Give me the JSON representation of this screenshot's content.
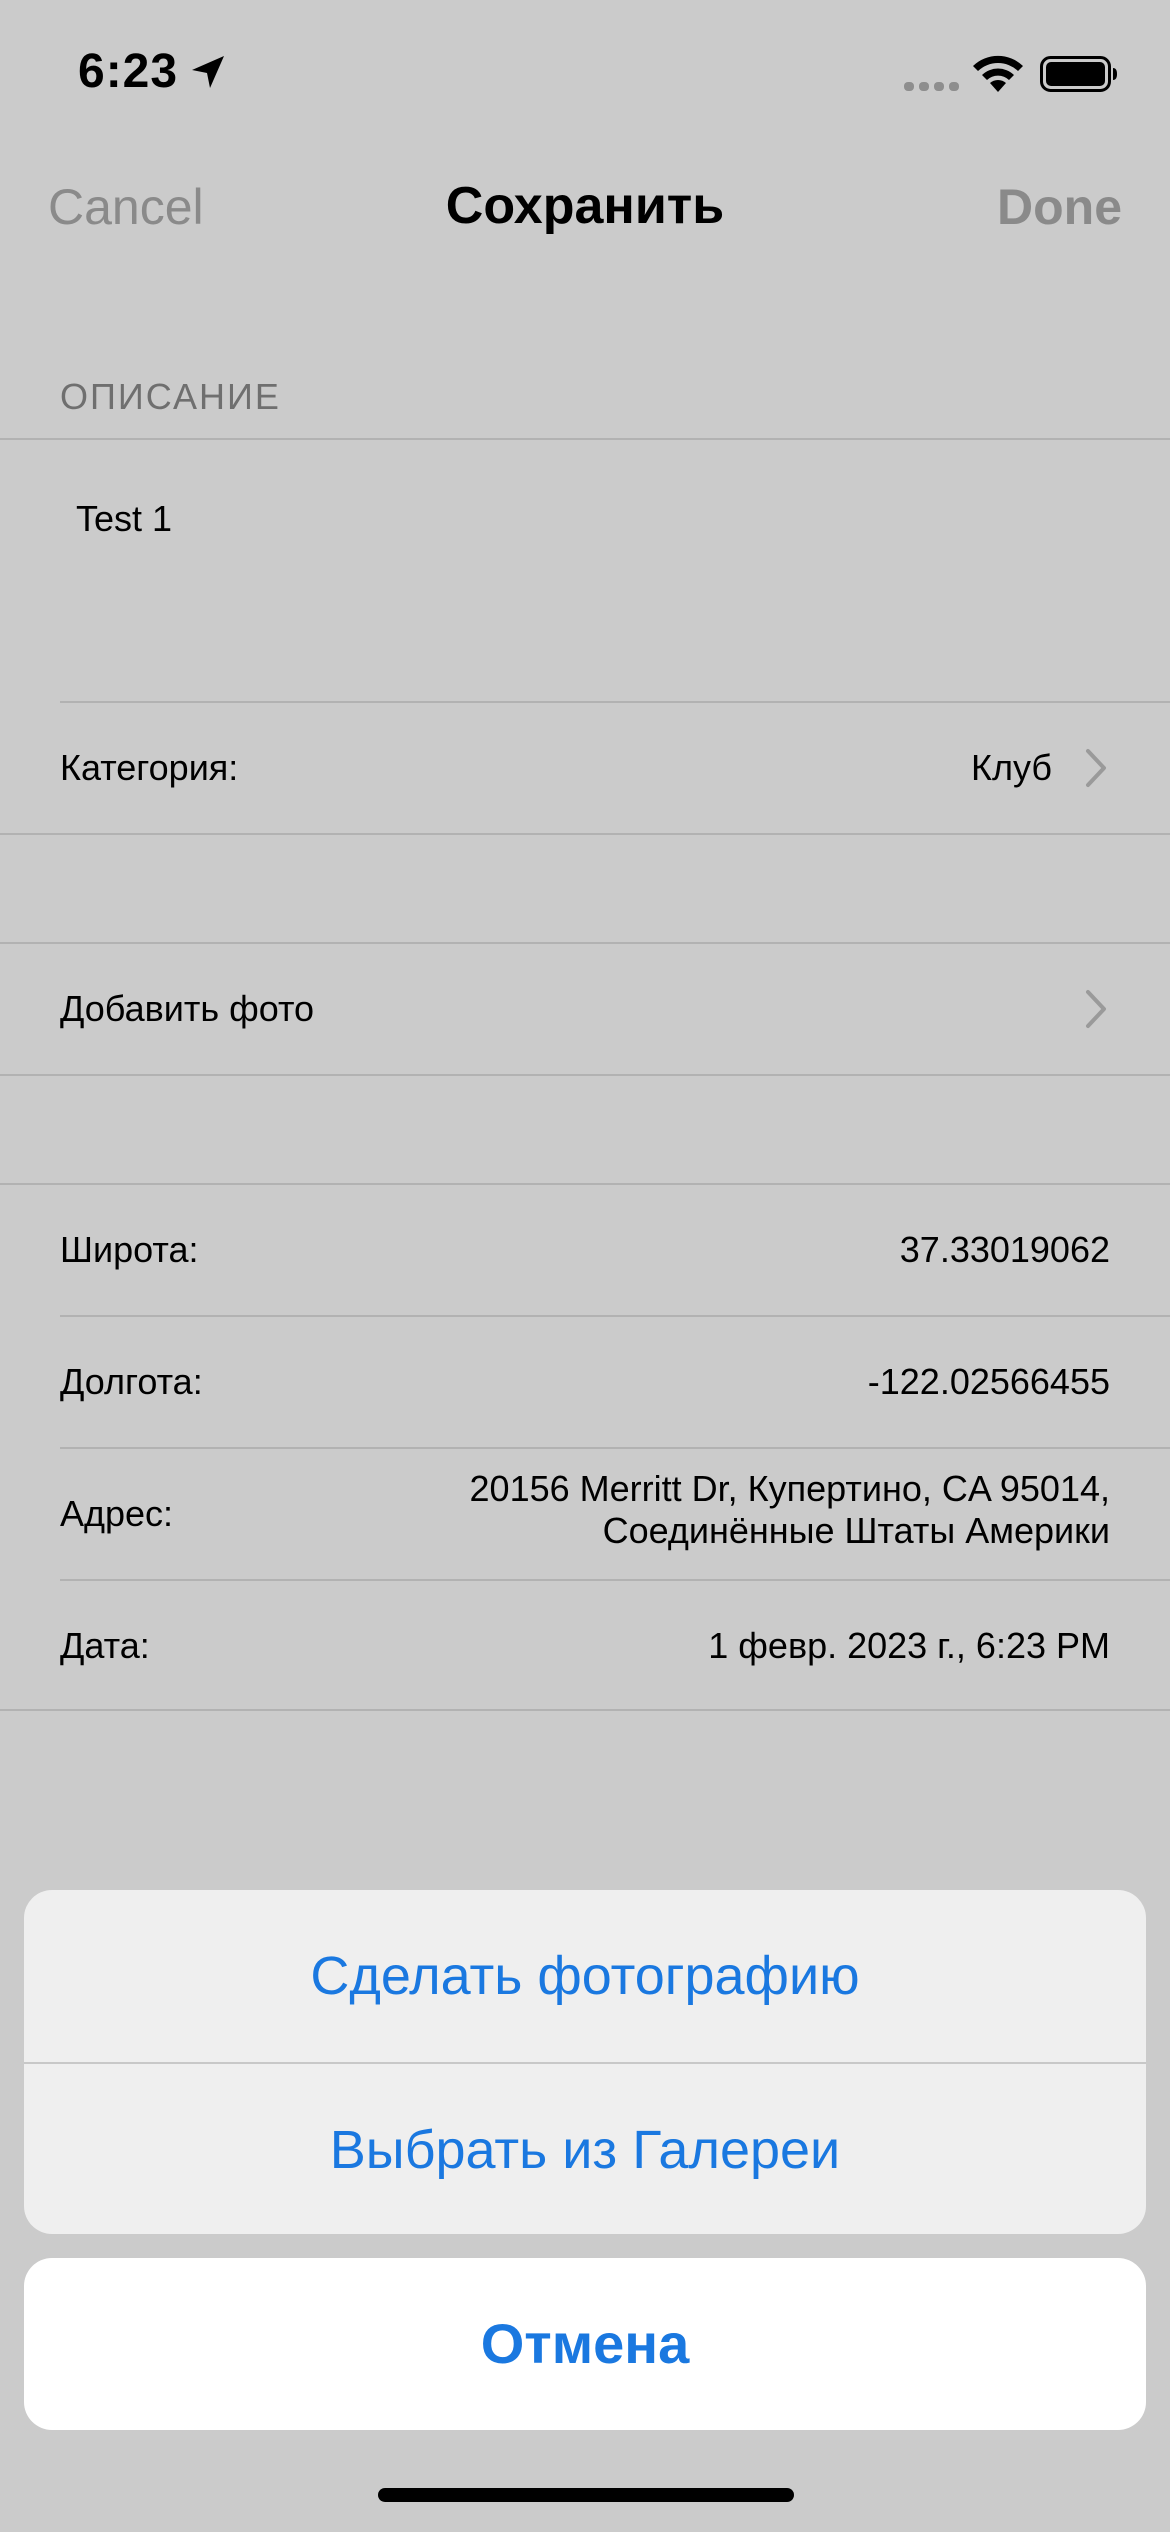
{
  "status_bar": {
    "time": "6:23",
    "location_icon": "location-arrow-icon",
    "signal_icon": "cellular-signal-icon",
    "wifi_icon": "wifi-icon",
    "battery_icon": "battery-icon"
  },
  "nav": {
    "cancel_label": "Cancel",
    "title": "Сохранить",
    "done_label": "Done"
  },
  "form": {
    "section_header": "ОПИСАНИЕ",
    "description_text": "Test 1",
    "category": {
      "label": "Категория:",
      "value": "Клуб"
    },
    "add_photo": {
      "label": "Добавить фото"
    },
    "latitude": {
      "label": "Широта:",
      "value": "37.33019062"
    },
    "longitude": {
      "label": "Долгота:",
      "value": "-122.02566455"
    },
    "address": {
      "label": "Адрес:",
      "line1": "20156 Merritt Dr, Купертино, CA 95014,",
      "line2": "Соединённые Штаты Америки"
    },
    "date": {
      "label": "Дата:",
      "value": "1 февр. 2023 г., 6:23 PM"
    }
  },
  "action_sheet": {
    "take_photo_label": "Сделать фотографию",
    "choose_gallery_label": "Выбрать из Галереи",
    "cancel_label": "Отмена"
  },
  "colors": {
    "background": "#cbcbcb",
    "accent": "#1a78e0",
    "muted_text": "#8a8a8a"
  }
}
